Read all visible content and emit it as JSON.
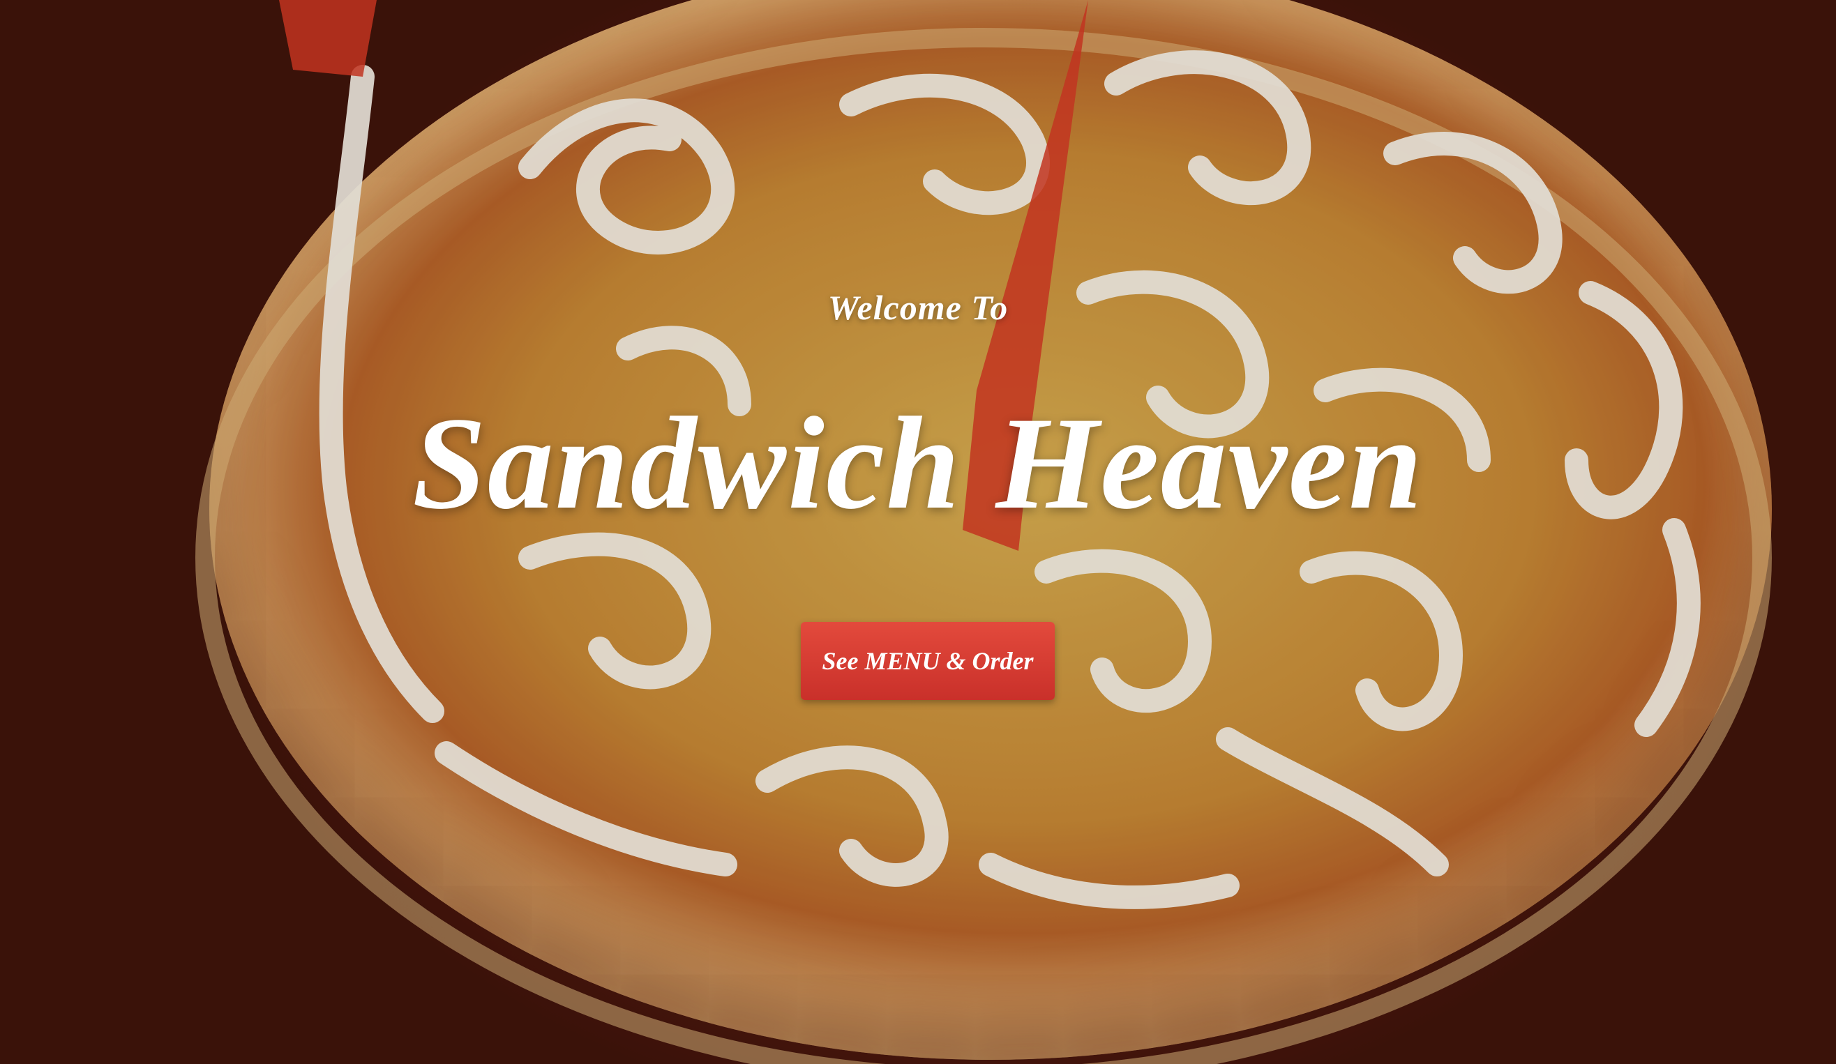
{
  "hero": {
    "welcome_text": "Welcome To",
    "title": "Sandwich Heaven",
    "cta_label": "See MENU & Order",
    "background_image": "pancake-with-icing-photo"
  },
  "colors": {
    "cta_background": "#d33a31",
    "text": "#ffffff",
    "backdrop": "#5a1d12"
  }
}
